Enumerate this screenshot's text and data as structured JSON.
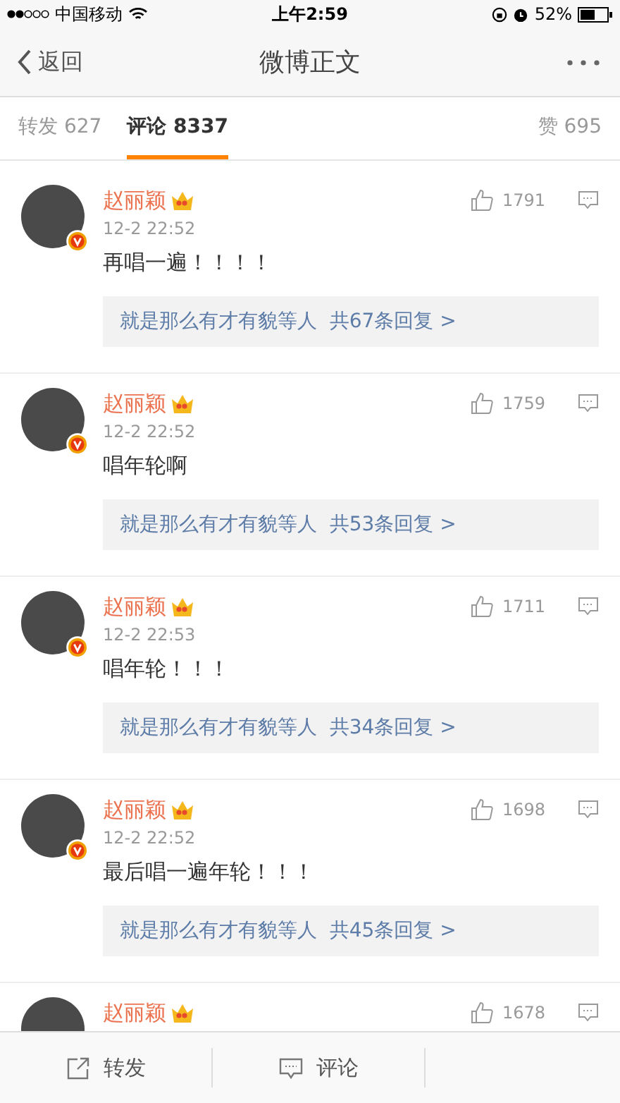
{
  "status_bar": {
    "carrier": "中国移动",
    "time": "上午2:59",
    "battery": "52%"
  },
  "nav": {
    "back": "返回",
    "title": "微博正文"
  },
  "tabs": [
    {
      "label": "转发 627",
      "selected": false
    },
    {
      "label": "评论 8337",
      "selected": true
    },
    {
      "label": "赞 695",
      "selected": false
    }
  ],
  "comments": [
    {
      "name": "赵丽颖",
      "likes": "1791",
      "time": "12-2 22:52",
      "text": "再唱一遍！！！！",
      "reply_users": "就是那么有才有貌等人",
      "reply_count": "共67条回复 >"
    },
    {
      "name": "赵丽颖",
      "likes": "1759",
      "time": "12-2 22:52",
      "text": "唱年轮啊",
      "reply_users": "就是那么有才有貌等人",
      "reply_count": "共53条回复 >"
    },
    {
      "name": "赵丽颖",
      "likes": "1711",
      "time": "12-2 22:53",
      "text": "唱年轮！！！",
      "reply_users": "就是那么有才有貌等人",
      "reply_count": "共34条回复 >"
    },
    {
      "name": "赵丽颖",
      "likes": "1698",
      "time": "12-2 22:52",
      "text": "最后唱一遍年轮！！！",
      "reply_users": "就是那么有才有貌等人",
      "reply_count": "共45条回复 >"
    },
    {
      "name": "赵丽颖",
      "likes": "1678"
    }
  ],
  "bottom_bar": [
    {
      "label": "转发",
      "kind": "repost"
    },
    {
      "label": "评论",
      "kind": "comment"
    }
  ]
}
